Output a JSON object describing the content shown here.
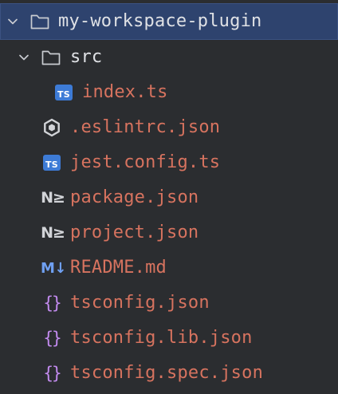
{
  "project_tree": {
    "root": {
      "name": "my-workspace-plugin",
      "expanded": true,
      "icon": "folder-icon"
    },
    "src_folder": {
      "name": "src",
      "expanded": true,
      "icon": "folder-icon"
    },
    "files": {
      "index_ts": {
        "name": "index.ts",
        "icon": "typescript-icon",
        "badge": "TS"
      },
      "eslintrc": {
        "name": ".eslintrc.json",
        "icon": "eslint-icon"
      },
      "jest_config": {
        "name": "jest.config.ts",
        "icon": "typescript-icon",
        "badge": "TS"
      },
      "package_json": {
        "name": "package.json",
        "icon": "nx-icon",
        "badge": "N≥"
      },
      "project_json": {
        "name": "project.json",
        "icon": "nx-icon",
        "badge": "N≥"
      },
      "readme": {
        "name": "README.md",
        "icon": "markdown-icon",
        "badge": "M↓"
      },
      "tsconfig": {
        "name": "tsconfig.json",
        "icon": "json-braces-icon",
        "badge": "{}"
      },
      "tsconfig_lib": {
        "name": "tsconfig.lib.json",
        "icon": "json-braces-icon",
        "badge": "{}"
      },
      "tsconfig_spec": {
        "name": "tsconfig.spec.json",
        "icon": "json-braces-icon",
        "badge": "{}"
      }
    }
  },
  "colors": {
    "background": "#2b2d30",
    "selected_row": "#2e436e",
    "folder_text": "#dfe1e5",
    "modified_file_text": "#d7735f",
    "typescript_badge": "#3d7bd6",
    "json_braces": "#c38bf0",
    "markdown": "#6fa0f2"
  }
}
